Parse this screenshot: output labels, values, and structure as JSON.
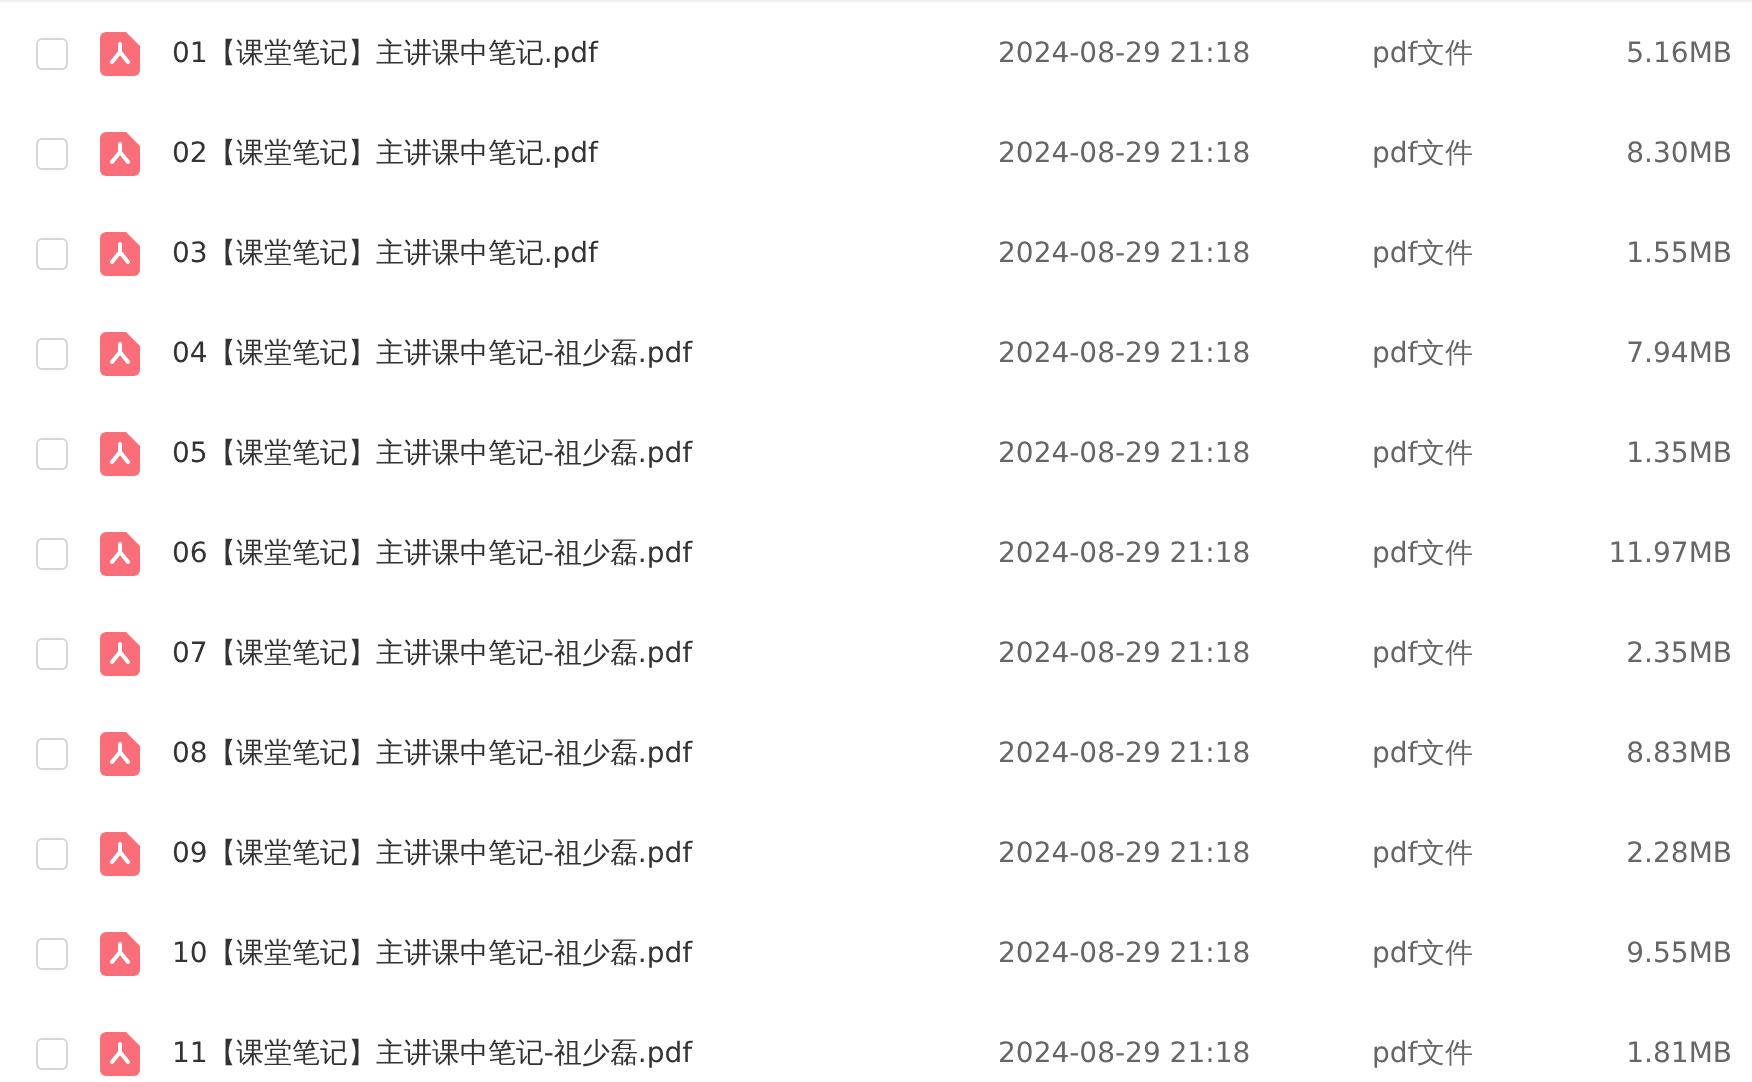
{
  "files": [
    {
      "name": "01【课堂笔记】主讲课中笔记.pdf",
      "date": "2024-08-29 21:18",
      "type": "pdf文件",
      "size": "5.16MB",
      "checked": false
    },
    {
      "name": "02【课堂笔记】主讲课中笔记.pdf",
      "date": "2024-08-29 21:18",
      "type": "pdf文件",
      "size": "8.30MB",
      "checked": false
    },
    {
      "name": "03【课堂笔记】主讲课中笔记.pdf",
      "date": "2024-08-29 21:18",
      "type": "pdf文件",
      "size": "1.55MB",
      "checked": false
    },
    {
      "name": "04【课堂笔记】主讲课中笔记-祖少磊.pdf",
      "date": "2024-08-29 21:18",
      "type": "pdf文件",
      "size": "7.94MB",
      "checked": false
    },
    {
      "name": "05【课堂笔记】主讲课中笔记-祖少磊.pdf",
      "date": "2024-08-29 21:18",
      "type": "pdf文件",
      "size": "1.35MB",
      "checked": false
    },
    {
      "name": "06【课堂笔记】主讲课中笔记-祖少磊.pdf",
      "date": "2024-08-29 21:18",
      "type": "pdf文件",
      "size": "11.97MB",
      "checked": false
    },
    {
      "name": "07【课堂笔记】主讲课中笔记-祖少磊.pdf",
      "date": "2024-08-29 21:18",
      "type": "pdf文件",
      "size": "2.35MB",
      "checked": false
    },
    {
      "name": "08【课堂笔记】主讲课中笔记-祖少磊.pdf",
      "date": "2024-08-29 21:18",
      "type": "pdf文件",
      "size": "8.83MB",
      "checked": false
    },
    {
      "name": "09【课堂笔记】主讲课中笔记-祖少磊.pdf",
      "date": "2024-08-29 21:18",
      "type": "pdf文件",
      "size": "2.28MB",
      "checked": false
    },
    {
      "name": "10【课堂笔记】主讲课中笔记-祖少磊.pdf",
      "date": "2024-08-29 21:18",
      "type": "pdf文件",
      "size": "9.55MB",
      "checked": false
    },
    {
      "name": "11【课堂笔记】主讲课中笔记-祖少磊.pdf",
      "date": "2024-08-29 21:18",
      "type": "pdf文件",
      "size": "1.81MB",
      "checked": false
    }
  ]
}
